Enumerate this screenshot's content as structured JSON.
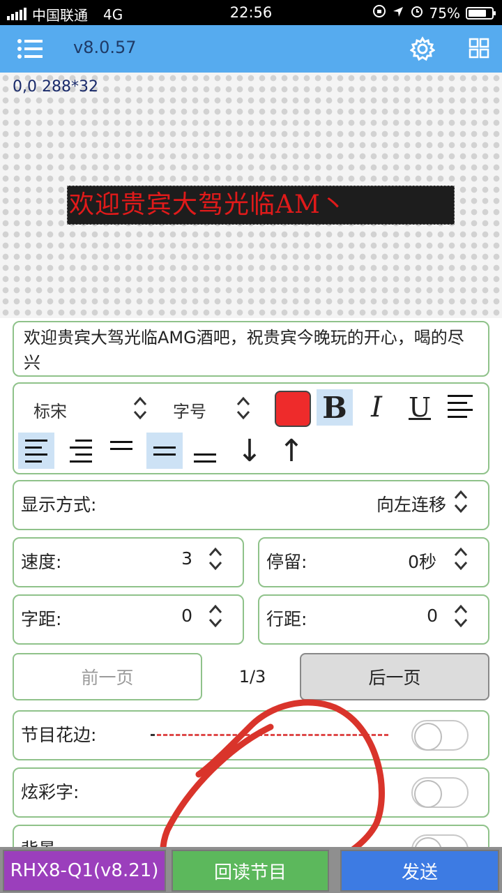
{
  "status_bar": {
    "carrier": "中国联通",
    "network": "4G",
    "time": "22:56",
    "battery": "75%"
  },
  "app_bar": {
    "version": "v8.0.57",
    "icons": [
      "menu-icon",
      "gear-icon",
      "grid-icon"
    ]
  },
  "preview": {
    "coords": "0,0 288*32",
    "led_text": "欢迎贵宾大驾光临AM丶",
    "led_color": "#e01a1a"
  },
  "text_input": {
    "value": "欢迎贵宾大驾光临AMG酒吧，祝贵宾今晚玩的开心，喝的尽兴"
  },
  "toolbar": {
    "font_name": "标宋",
    "font_size_label": "字号",
    "text_color": "#ee2b2b",
    "bold": "B",
    "italic": "I",
    "underline": "U",
    "down_arrow": "↓",
    "up_arrow": "↑"
  },
  "display_mode": {
    "label": "显示方式:",
    "value": "向左连移"
  },
  "speed": {
    "label": "速度:",
    "value": "3"
  },
  "stay": {
    "label": "停留:",
    "value": "0秒"
  },
  "char_spacing": {
    "label": "字距:",
    "value": "0"
  },
  "line_spacing": {
    "label": "行距:",
    "value": "0"
  },
  "pager": {
    "prev": "前一页",
    "page": "1/3",
    "next": "后一页"
  },
  "options": {
    "border": {
      "label": "节目花边:",
      "on": false
    },
    "colorful": {
      "label": "炫彩字:",
      "on": false
    },
    "background": {
      "label": "背景",
      "on": false
    }
  },
  "bottom_bar": {
    "device": "RHX8-Q1(v8.21)",
    "read_back": "回读节目",
    "send": "发送"
  }
}
